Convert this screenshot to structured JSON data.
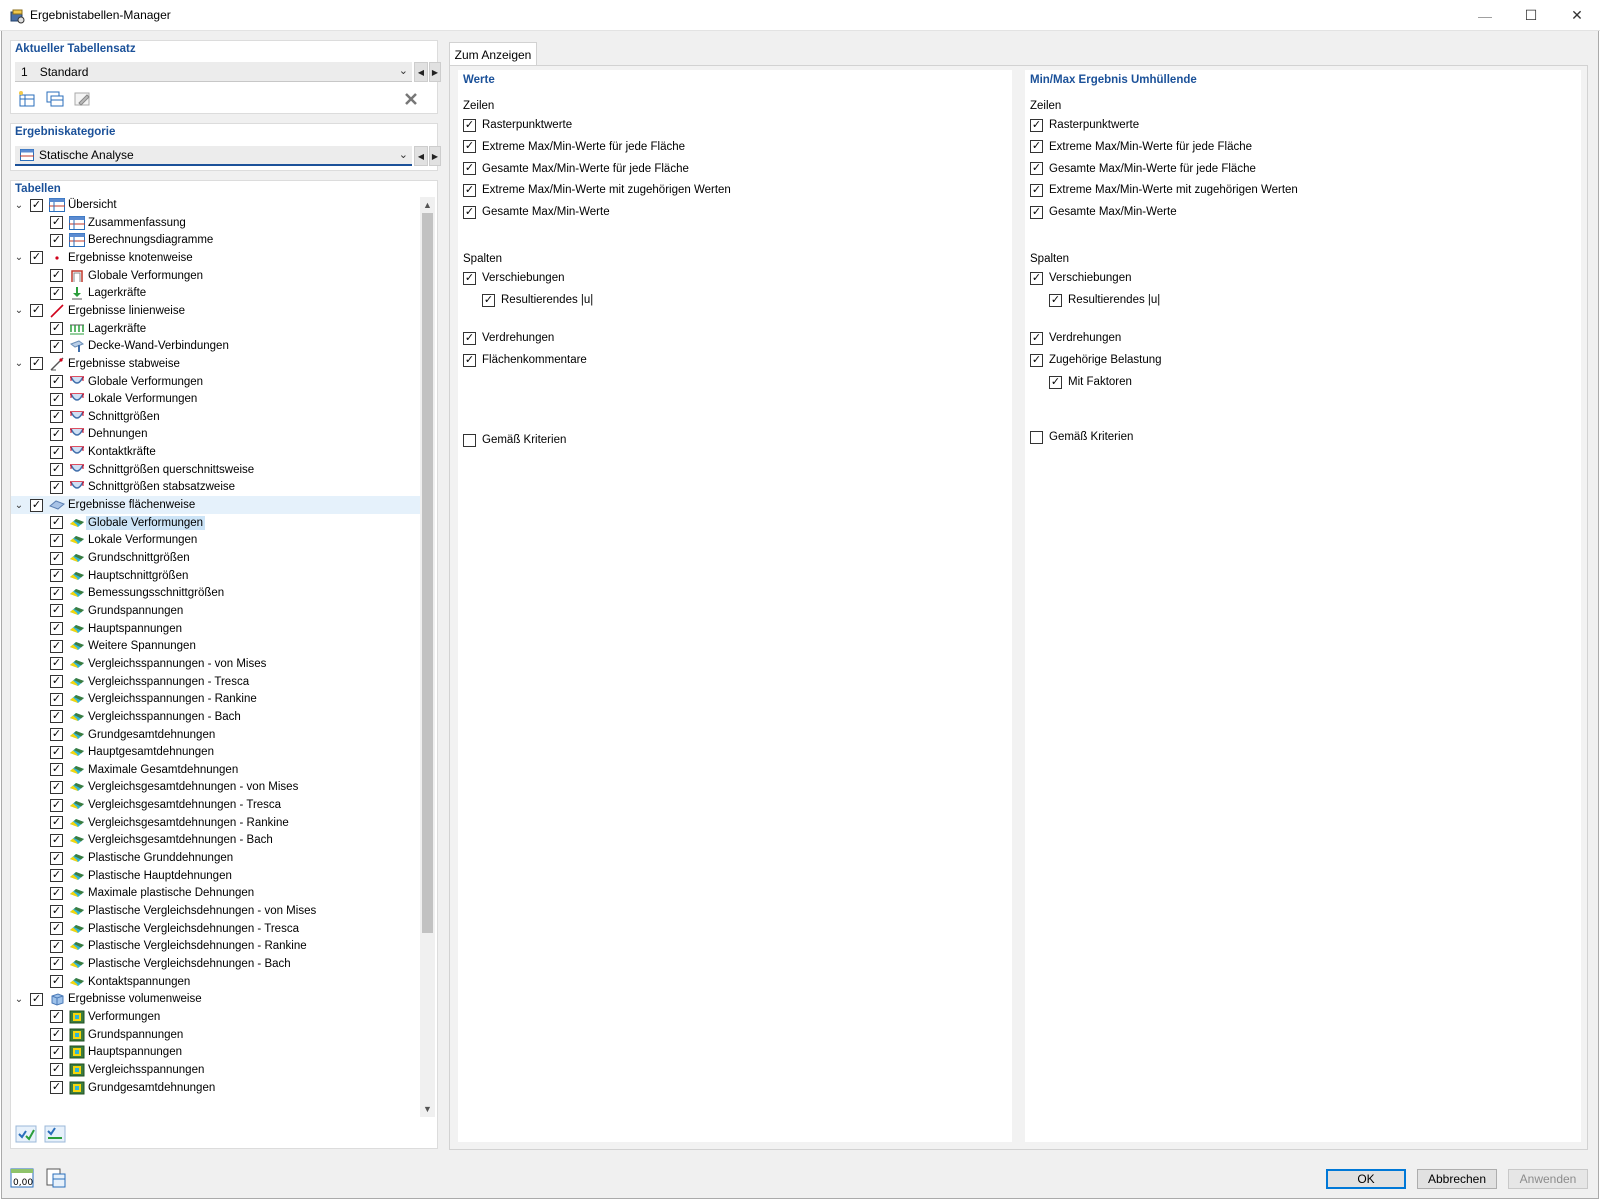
{
  "window": {
    "title": "Ergebnistabellen-Manager",
    "minimize_glyph": "—",
    "maximize_glyph": "☐",
    "close_glyph": "✕"
  },
  "left": {
    "tableset": {
      "heading": "Aktueller Tabellensatz",
      "number": "1",
      "value": "Standard"
    },
    "category": {
      "heading": "Ergebniskategorie",
      "value": "Statische Analyse"
    },
    "tables_heading": "Tabellen",
    "tree": [
      {
        "label": "Übersicht",
        "level": 0,
        "icon": "summary-table-icon",
        "expanded": true,
        "checked": true
      },
      {
        "label": "Zusammenfassung",
        "level": 1,
        "icon": "summary-table-icon",
        "checked": true
      },
      {
        "label": "Berechnungsdiagramme",
        "level": 1,
        "icon": "summary-table-icon",
        "checked": true
      },
      {
        "label": "Ergebnisse knotenweise",
        "level": 0,
        "icon": "node-icon",
        "expanded": true,
        "checked": true
      },
      {
        "label": "Globale Verformungen",
        "level": 1,
        "icon": "node-deformation-icon",
        "checked": true
      },
      {
        "label": "Lagerkräfte",
        "level": 1,
        "icon": "support-icon",
        "checked": true
      },
      {
        "label": "Ergebnisse linienweise",
        "level": 0,
        "icon": "line-icon",
        "expanded": true,
        "checked": true
      },
      {
        "label": "Lagerkräfte",
        "level": 1,
        "icon": "line-support-icon",
        "checked": true
      },
      {
        "label": "Decke-Wand-Verbindungen",
        "level": 1,
        "icon": "slab-wall-icon",
        "checked": true
      },
      {
        "label": "Ergebnisse stabweise",
        "level": 0,
        "icon": "member-icon",
        "expanded": true,
        "checked": true
      },
      {
        "label": "Globale Verformungen",
        "level": 1,
        "icon": "member-result-icon",
        "checked": true
      },
      {
        "label": "Lokale Verformungen",
        "level": 1,
        "icon": "member-result-icon",
        "checked": true
      },
      {
        "label": "Schnittgrößen",
        "level": 1,
        "icon": "member-result-icon",
        "checked": true
      },
      {
        "label": "Dehnungen",
        "level": 1,
        "icon": "member-result-icon",
        "checked": true
      },
      {
        "label": "Kontaktkräfte",
        "level": 1,
        "icon": "member-result-icon",
        "checked": true
      },
      {
        "label": "Schnittgrößen querschnittsweise",
        "level": 1,
        "icon": "member-result-icon",
        "checked": true
      },
      {
        "label": "Schnittgrößen stabsatzweise",
        "level": 1,
        "icon": "member-result-icon",
        "checked": true
      },
      {
        "label": "Ergebnisse flächenweise",
        "level": 0,
        "icon": "surface-icon",
        "expanded": true,
        "checked": true,
        "selparent": true
      },
      {
        "label": "Globale Verformungen",
        "level": 1,
        "icon": "surface-result-icon",
        "checked": true,
        "selected": true
      },
      {
        "label": "Lokale Verformungen",
        "level": 1,
        "icon": "surface-result-icon",
        "checked": true
      },
      {
        "label": "Grundschnittgrößen",
        "level": 1,
        "icon": "surface-result-icon",
        "checked": true
      },
      {
        "label": "Hauptschnittgrößen",
        "level": 1,
        "icon": "surface-result-icon",
        "checked": true
      },
      {
        "label": "Bemessungsschnittgrößen",
        "level": 1,
        "icon": "surface-result-icon",
        "checked": true
      },
      {
        "label": "Grundspannungen",
        "level": 1,
        "icon": "surface-result-icon",
        "checked": true
      },
      {
        "label": "Hauptspannungen",
        "level": 1,
        "icon": "surface-result-icon",
        "checked": true
      },
      {
        "label": "Weitere Spannungen",
        "level": 1,
        "icon": "surface-result-icon",
        "checked": true
      },
      {
        "label": "Vergleichsspannungen - von Mises",
        "level": 1,
        "icon": "surface-result-icon",
        "checked": true
      },
      {
        "label": "Vergleichsspannungen - Tresca",
        "level": 1,
        "icon": "surface-result-icon",
        "checked": true
      },
      {
        "label": "Vergleichsspannungen - Rankine",
        "level": 1,
        "icon": "surface-result-icon",
        "checked": true
      },
      {
        "label": "Vergleichsspannungen - Bach",
        "level": 1,
        "icon": "surface-result-icon",
        "checked": true
      },
      {
        "label": "Grundgesamtdehnungen",
        "level": 1,
        "icon": "surface-result-icon",
        "checked": true
      },
      {
        "label": "Hauptgesamtdehnungen",
        "level": 1,
        "icon": "surface-result-icon",
        "checked": true
      },
      {
        "label": "Maximale Gesamtdehnungen",
        "level": 1,
        "icon": "surface-result-icon",
        "checked": true
      },
      {
        "label": "Vergleichsgesamtdehnungen - von Mises",
        "level": 1,
        "icon": "surface-result-icon",
        "checked": true
      },
      {
        "label": "Vergleichsgesamtdehnungen - Tresca",
        "level": 1,
        "icon": "surface-result-icon",
        "checked": true
      },
      {
        "label": "Vergleichsgesamtdehnungen - Rankine",
        "level": 1,
        "icon": "surface-result-icon",
        "checked": true
      },
      {
        "label": "Vergleichsgesamtdehnungen - Bach",
        "level": 1,
        "icon": "surface-result-icon",
        "checked": true
      },
      {
        "label": "Plastische Grunddehnungen",
        "level": 1,
        "icon": "surface-result-icon",
        "checked": true
      },
      {
        "label": "Plastische Hauptdehnungen",
        "level": 1,
        "icon": "surface-result-icon",
        "checked": true
      },
      {
        "label": "Maximale plastische Dehnungen",
        "level": 1,
        "icon": "surface-result-icon",
        "checked": true
      },
      {
        "label": "Plastische Vergleichsdehnungen - von Mises",
        "level": 1,
        "icon": "surface-result-icon",
        "checked": true
      },
      {
        "label": "Plastische Vergleichsdehnungen - Tresca",
        "level": 1,
        "icon": "surface-result-icon",
        "checked": true
      },
      {
        "label": "Plastische Vergleichsdehnungen - Rankine",
        "level": 1,
        "icon": "surface-result-icon",
        "checked": true
      },
      {
        "label": "Plastische Vergleichsdehnungen - Bach",
        "level": 1,
        "icon": "surface-result-icon",
        "checked": true
      },
      {
        "label": "Kontaktspannungen",
        "level": 1,
        "icon": "surface-result-icon",
        "checked": true
      },
      {
        "label": "Ergebnisse volumenweise",
        "level": 0,
        "icon": "solid-icon",
        "expanded": true,
        "checked": true
      },
      {
        "label": "Verformungen",
        "level": 1,
        "icon": "solid-result-icon",
        "checked": true
      },
      {
        "label": "Grundspannungen",
        "level": 1,
        "icon": "solid-result-icon",
        "checked": true
      },
      {
        "label": "Hauptspannungen",
        "level": 1,
        "icon": "solid-result-icon",
        "checked": true
      },
      {
        "label": "Vergleichsspannungen",
        "level": 1,
        "icon": "solid-result-icon",
        "checked": true
      },
      {
        "label": "Grundgesamtdehnungen",
        "level": 1,
        "icon": "solid-result-icon",
        "checked": true
      }
    ]
  },
  "right": {
    "tab_label": "Zum Anzeigen",
    "werte": {
      "heading": "Werte",
      "zeilen_heading": "Zeilen",
      "zeilen": [
        {
          "label": "Rasterpunktwerte",
          "checked": true
        },
        {
          "label": "Extreme Max/Min-Werte für jede Fläche",
          "checked": true
        },
        {
          "label": "Gesamte Max/Min-Werte für jede Fläche",
          "checked": true
        },
        {
          "label": "Extreme Max/Min-Werte mit zugehörigen Werten",
          "checked": true
        },
        {
          "label": "Gesamte Max/Min-Werte",
          "checked": true
        }
      ],
      "spalten_heading": "Spalten",
      "spalten": [
        {
          "label": "Verschiebungen",
          "checked": true
        },
        {
          "label": "Resultierendes |u|",
          "checked": true
        },
        {
          "label": "Verdrehungen",
          "checked": true
        },
        {
          "label": "Flächenkommentare",
          "checked": true
        }
      ],
      "kriterien": {
        "label": "Gemäß Kriterien",
        "checked": false
      }
    },
    "minmax": {
      "heading": "Min/Max Ergebnis Umhüllende",
      "zeilen_heading": "Zeilen",
      "zeilen": [
        {
          "label": "Rasterpunktwerte",
          "checked": true
        },
        {
          "label": "Extreme Max/Min-Werte für jede Fläche",
          "checked": true
        },
        {
          "label": "Gesamte Max/Min-Werte für jede Fläche",
          "checked": true
        },
        {
          "label": "Extreme Max/Min-Werte mit zugehörigen Werten",
          "checked": true
        },
        {
          "label": "Gesamte Max/Min-Werte",
          "checked": true
        }
      ],
      "spalten_heading": "Spalten",
      "spalten": [
        {
          "label": "Verschiebungen",
          "checked": true
        },
        {
          "label": "Resultierendes |u|",
          "checked": true
        },
        {
          "label": "Verdrehungen",
          "checked": true
        },
        {
          "label": "Zugehörige Belastung",
          "checked": true
        },
        {
          "label": "Mit Faktoren",
          "checked": true
        }
      ],
      "kriterien": {
        "label": "Gemäß Kriterien",
        "checked": false
      }
    }
  },
  "footer": {
    "decimal_label": "0,00",
    "ok": "OK",
    "cancel": "Abbrechen",
    "apply": "Anwenden"
  },
  "colors": {
    "heading_blue": "#1b5199",
    "selection": "#cce4f7",
    "primary_border": "#0078d7"
  }
}
